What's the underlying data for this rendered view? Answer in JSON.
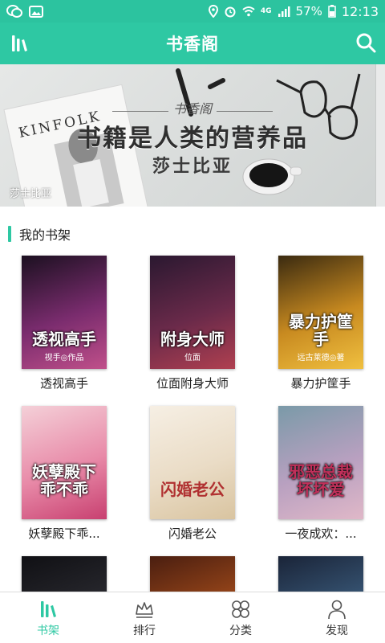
{
  "status_bar": {
    "network": "4G",
    "battery": "57%",
    "time": "12:13"
  },
  "app_bar": {
    "title": "书香阁"
  },
  "banner": {
    "logo": "书香阁",
    "headline": "书籍是人类的营养品",
    "author": "莎士比亚",
    "caption": "莎士比亚",
    "magazine": "KINFOLK"
  },
  "shelf": {
    "title": "我的书架",
    "books": [
      {
        "name": "透视高手",
        "cover_title": "透视高手",
        "cover_sub": "视手◎作品",
        "colors": [
          "#1b1020",
          "#7a2c6e",
          "#c0508a"
        ]
      },
      {
        "name": "位面附身大师",
        "cover_title": "附身大师",
        "cover_sub": "位面",
        "colors": [
          "#2a1830",
          "#6a2a4a",
          "#b04050"
        ]
      },
      {
        "name": "暴力护筐手",
        "cover_title": "暴力护筐手",
        "cover_sub": "远古莱德◎著",
        "colors": [
          "#3a2a10",
          "#c88a20",
          "#f0c040"
        ]
      },
      {
        "name": "妖孽殿下乖...",
        "cover_title": "妖孽殿下乖不乖",
        "cover_sub": "",
        "colors": [
          "#f4d0d8",
          "#e88aa8",
          "#c84070"
        ]
      },
      {
        "name": "闪婚老公",
        "cover_title": "闪婚老公",
        "cover_sub": "",
        "colors": [
          "#f6efe4",
          "#eadcc6",
          "#d9c4a0"
        ]
      },
      {
        "name": "一夜成欢：...",
        "cover_title": "邪恶总裁坏坏爱",
        "cover_sub": "",
        "colors": [
          "#7a9aa8",
          "#b8a0c0",
          "#e0b8c8"
        ]
      },
      {
        "name": "",
        "cover_title": "",
        "cover_sub": "",
        "colors": [
          "#101014",
          "#2a2a30",
          "#45404a"
        ]
      },
      {
        "name": "",
        "cover_title": "",
        "cover_sub": "",
        "colors": [
          "#4a1e10",
          "#a04a1a",
          "#e08a30"
        ]
      },
      {
        "name": "",
        "cover_title": "",
        "cover_sub": "",
        "colors": [
          "#1a2438",
          "#3a5a7a",
          "#6a8aa8"
        ]
      }
    ]
  },
  "bottom_nav": {
    "items": [
      {
        "label": "书架",
        "icon": "bookshelf-icon",
        "active": true
      },
      {
        "label": "排行",
        "icon": "crown-icon",
        "active": false
      },
      {
        "label": "分类",
        "icon": "category-icon",
        "active": false
      },
      {
        "label": "发现",
        "icon": "discover-icon",
        "active": false
      }
    ]
  },
  "colors": {
    "accent": "#2ec8a3",
    "status_bar": "#2cc39f"
  }
}
